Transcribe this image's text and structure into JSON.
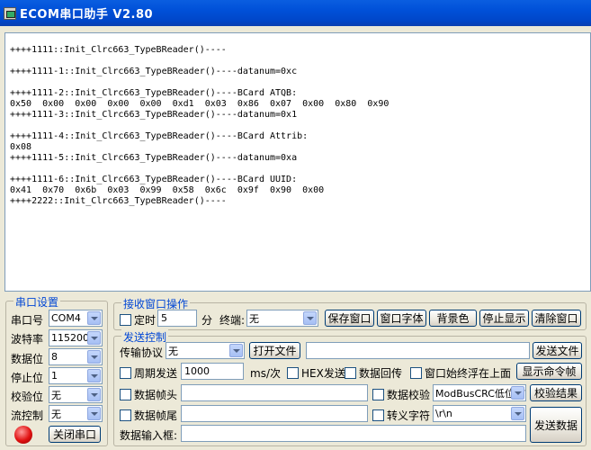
{
  "window": {
    "title": "ECOM串口助手   V2.80",
    "icon": "app-icon"
  },
  "receive": {
    "lines": [
      "++++1111::Init_Clrc663_TypeBReader()----",
      "",
      "++++1111-1::Init_Clrc663_TypeBReader()----datanum=0xc",
      "",
      "++++1111-2::Init_Clrc663_TypeBReader()----BCard ATQB:",
      "0x50  0x00  0x00  0x00  0x00  0xd1  0x03  0x86  0x07  0x00  0x80  0x90",
      "++++1111-3::Init_Clrc663_TypeBReader()----datanum=0x1",
      "",
      "++++1111-4::Init_Clrc663_TypeBReader()----BCard Attrib:",
      "0x08",
      "++++1111-5::Init_Clrc663_TypeBReader()----datanum=0xa",
      "",
      "++++1111-6::Init_Clrc663_TypeBReader()----BCard UUID:",
      "0x41  0x70  0x6b  0x03  0x99  0x58  0x6c  0x9f  0x90  0x00",
      "++++2222::Init_Clrc663_TypeBReader()----"
    ]
  },
  "serial": {
    "title": "串口设置",
    "port_label": "串口号",
    "port_value": "COM4",
    "baud_label": "波特率",
    "baud_value": "115200",
    "databits_label": "数据位",
    "databits_value": "8",
    "stopbits_label": "停止位",
    "stopbits_value": "1",
    "parity_label": "校验位",
    "parity_value": "无",
    "flow_label": "流控制",
    "flow_value": "无",
    "close_button": "关闭串口",
    "status_color": "#e01010"
  },
  "recv_ops": {
    "title": "接收窗口操作",
    "timer_label": "定时",
    "timer_value": "5",
    "minute_label": "分",
    "terminator_label": "终端:",
    "terminator_value": "无",
    "save_button": "保存窗口",
    "font_button": "窗口字体",
    "bg_button": "背景色",
    "stop_button": "停止显示",
    "clear_button": "清除窗口"
  },
  "send_ctrl": {
    "title": "发送控制",
    "protocol_label": "传输协议",
    "protocol_value": "无",
    "open_file_button": "打开文件",
    "file_path": "",
    "send_file_button": "发送文件",
    "cyclic_label": "周期发送",
    "cyclic_value": "1000",
    "unit_label": "ms/次",
    "hex_label": "HEX发送",
    "echo_label": "数据回传",
    "topmost_label": "窗口始终浮在上面",
    "show_cmd_button": "显示命令帧",
    "header_label": "数据帧头",
    "header_value": "",
    "checksum_label": "数据校验",
    "checksum_value": "ModBusCRC低位在前",
    "checksum_result_button": "校验结果",
    "tail_label": "数据帧尾",
    "tail_value": "",
    "escape_label": "转义字符",
    "escape_value": "\\r\\n",
    "input_label": "数据输入框:",
    "input_value": "",
    "send_button": "发送数据"
  }
}
